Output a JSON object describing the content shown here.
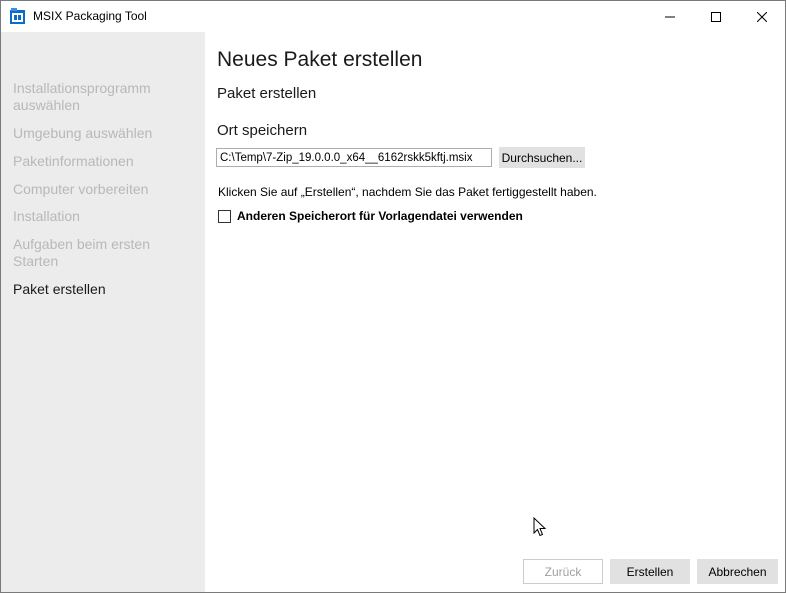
{
  "window": {
    "title": "MSIX Packaging Tool",
    "controls": {
      "minimize": "minimize-icon",
      "maximize": "maximize-icon",
      "close": "close-icon"
    }
  },
  "sidebar": {
    "items": [
      {
        "label": "Installationsprogramm auswählen",
        "active": false
      },
      {
        "label": "Umgebung auswählen",
        "active": false
      },
      {
        "label": "Paketinformationen",
        "active": false
      },
      {
        "label": "Computer vorbereiten",
        "active": false
      },
      {
        "label": "Installation",
        "active": false
      },
      {
        "label": "Aufgaben beim ersten Starten",
        "active": false
      },
      {
        "label": "Paket erstellen",
        "active": true
      }
    ]
  },
  "main": {
    "page_title": "Neues Paket erstellen",
    "section_title": "Paket erstellen",
    "save_location_label": "Ort speichern",
    "path_value": "C:\\Temp\\7-Zip_19.0.0.0_x64__6162rskk5kftj.msix",
    "browse_label": "Durchsuchen...",
    "info_text": "Klicken Sie auf „Erstellen“, nachdem Sie das Paket fertiggestellt haben.",
    "checkbox_label": "Anderen Speicherort für Vorlagendatei verwenden",
    "checkbox_checked": false
  },
  "footer": {
    "back_label": "Zurück",
    "create_label": "Erstellen",
    "cancel_label": "Abbrechen"
  },
  "colors": {
    "sidebar_bg": "#ececec",
    "inactive_nav": "#b8b8b8",
    "button_bg": "#e1e1e1",
    "app_icon_blue": "#0b6bcb"
  }
}
